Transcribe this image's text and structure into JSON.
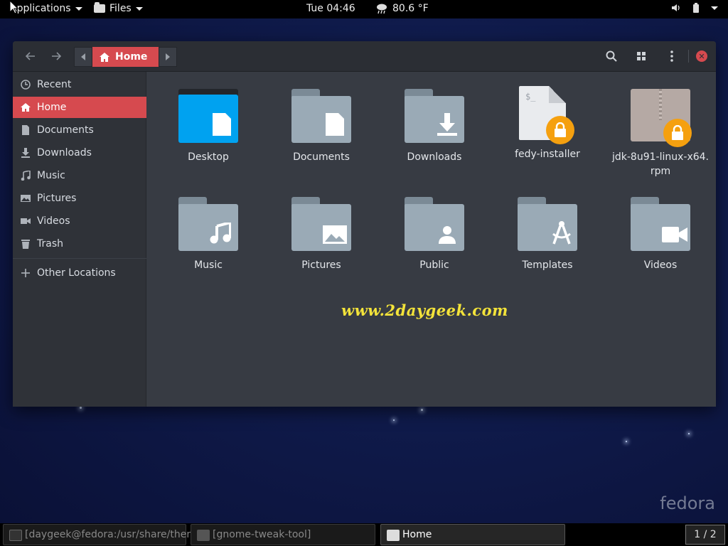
{
  "topbar": {
    "applications": "Applications",
    "files": "Files",
    "clock": "Tue 04:46",
    "weather": "80.6 °F"
  },
  "window": {
    "breadcrumb": "Home",
    "sidebar": [
      {
        "label": "Recent",
        "icon": "clock-icon"
      },
      {
        "label": "Home",
        "icon": "home-icon",
        "active": true
      },
      {
        "label": "Documents",
        "icon": "document-icon"
      },
      {
        "label": "Downloads",
        "icon": "download-icon"
      },
      {
        "label": "Music",
        "icon": "music-icon"
      },
      {
        "label": "Pictures",
        "icon": "picture-icon"
      },
      {
        "label": "Videos",
        "icon": "video-icon"
      },
      {
        "label": "Trash",
        "icon": "trash-icon"
      },
      {
        "label": "Other Locations",
        "icon": "plus-icon"
      }
    ],
    "items": [
      {
        "label": "Desktop",
        "kind": "desktop-folder"
      },
      {
        "label": "Documents",
        "kind": "documents-folder"
      },
      {
        "label": "Downloads",
        "kind": "downloads-folder"
      },
      {
        "label": "fedy-installer",
        "kind": "script-file-locked"
      },
      {
        "label": "jdk-8u91-linux-x64.\nrpm",
        "kind": "archive-file-locked"
      },
      {
        "label": "Music",
        "kind": "music-folder"
      },
      {
        "label": "Pictures",
        "kind": "pictures-folder"
      },
      {
        "label": "Public",
        "kind": "public-folder"
      },
      {
        "label": "Templates",
        "kind": "templates-folder"
      },
      {
        "label": "Videos",
        "kind": "videos-folder"
      }
    ]
  },
  "watermark": "www.2daygeek.com",
  "brand": "fedora",
  "taskbar": {
    "tasks": [
      {
        "label": "[daygeek@fedora:/usr/share/them..."
      },
      {
        "label": "[gnome-tweak-tool]"
      },
      {
        "label": "Home"
      }
    ],
    "pager": "1 / 2"
  },
  "colors": {
    "accent": "#d64a4f",
    "folder": "#9aaab6",
    "desktop_folder": "#00a2f0",
    "lock": "#f5a00f",
    "watermark": "#f3e33a"
  }
}
